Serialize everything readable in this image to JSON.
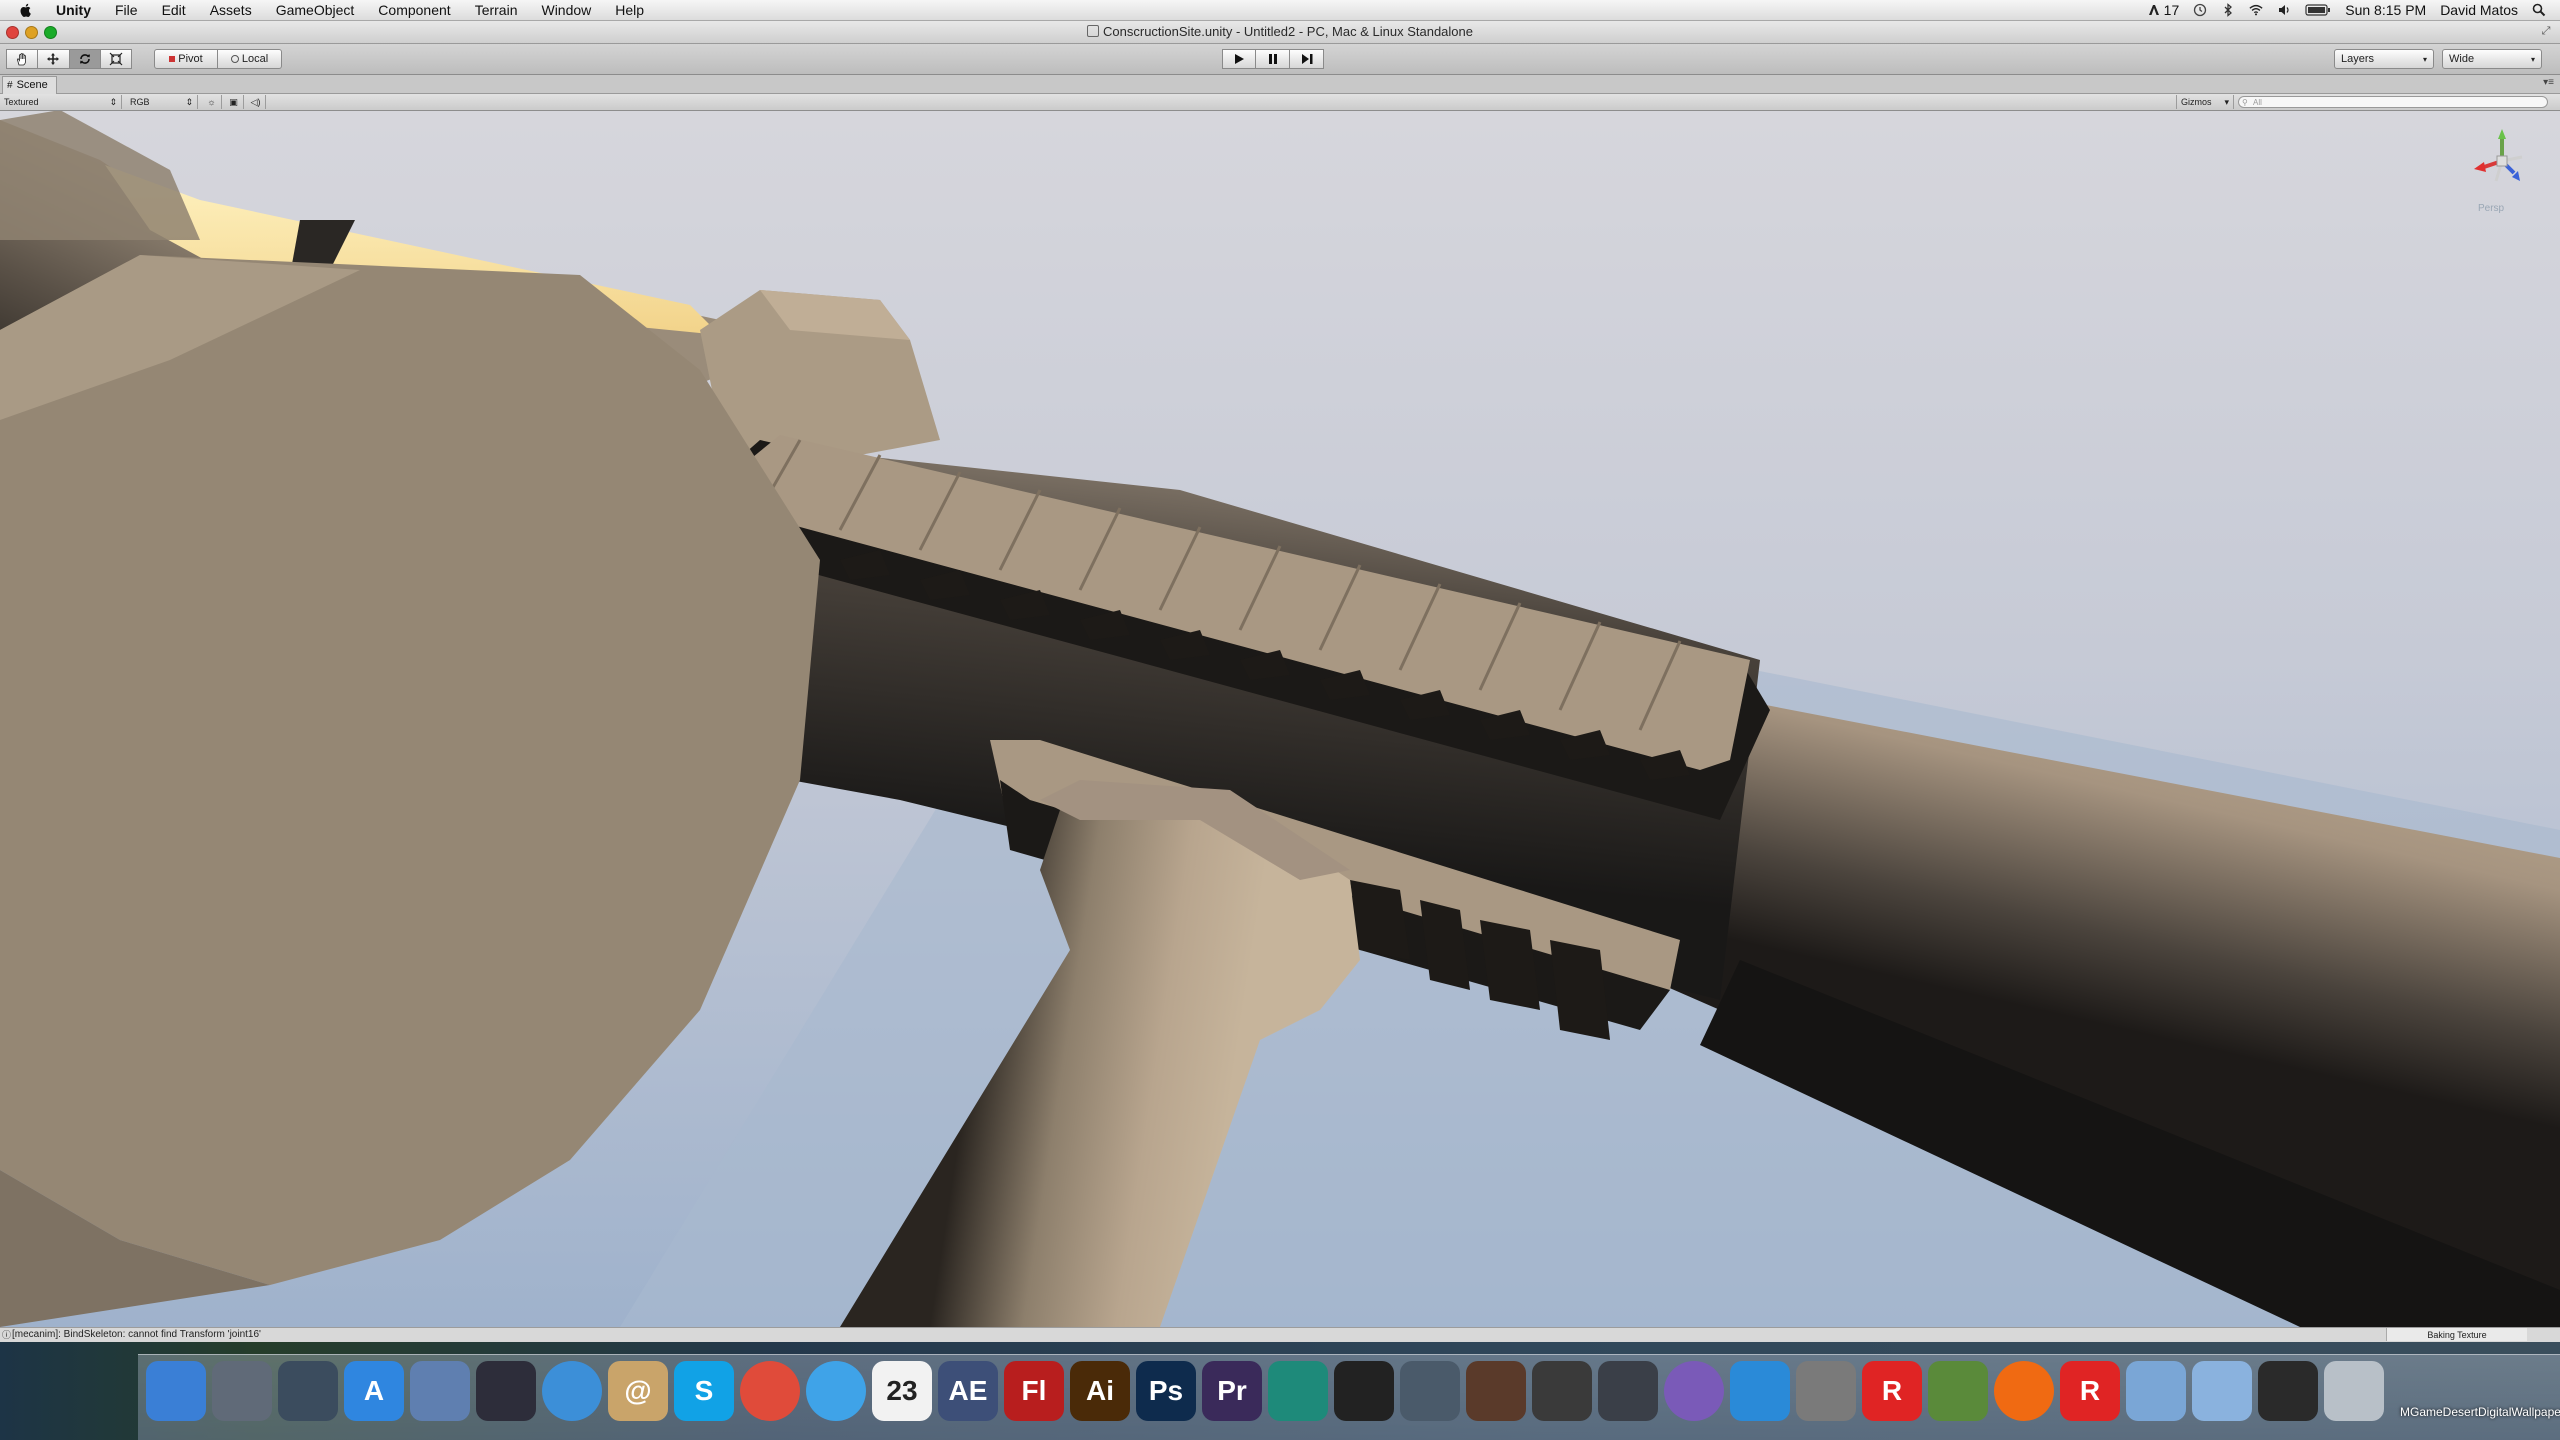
{
  "menubar": {
    "app": "Unity",
    "items": [
      "File",
      "Edit",
      "Assets",
      "GameObject",
      "Component",
      "Terrain",
      "Window",
      "Help"
    ],
    "status_badge": "17",
    "clock": "Sun 8:15 PM",
    "user": "David Matos"
  },
  "window": {
    "title": "ConscructionSite.unity - Untitled2 - PC, Mac & Linux Standalone"
  },
  "toolbar": {
    "pivot_label": "Pivot",
    "local_label": "Local",
    "layers_label": "Layers",
    "layout_label": "Wide"
  },
  "scene": {
    "tab_label": "Scene",
    "draw_mode": "Textured",
    "render_mode": "RGB",
    "gizmos_label": "Gizmos",
    "search_placeholder": "All",
    "gizmo_label": "Persp"
  },
  "status": {
    "message": "[mecanim]: BindSkeleton: cannot find Transform 'joint16'",
    "progress_label": "Baking Texture"
  },
  "dock": {
    "items": [
      {
        "name": "finder",
        "label": "",
        "color": "#3a7fd6"
      },
      {
        "name": "launchpad",
        "label": "",
        "color": "#606a78"
      },
      {
        "name": "mission-control",
        "label": "",
        "color": "#3b4c5e"
      },
      {
        "name": "app-store",
        "label": "A",
        "color": "#2f86e0"
      },
      {
        "name": "preview",
        "label": "",
        "color": "#5f7fb0"
      },
      {
        "name": "pencil-app",
        "label": "",
        "color": "#2d2d3a"
      },
      {
        "name": "safari",
        "label": "",
        "color": "#3c8fd8"
      },
      {
        "name": "contacts",
        "label": "@",
        "color": "#c9a46a"
      },
      {
        "name": "skype",
        "label": "S",
        "color": "#11a2e6"
      },
      {
        "name": "chrome",
        "label": "",
        "color": "#e04b3a"
      },
      {
        "name": "itunes",
        "label": "",
        "color": "#3fa3e8"
      },
      {
        "name": "calendar",
        "label": "23",
        "color": "#f2f2f2"
      },
      {
        "name": "after-effects",
        "label": "AE",
        "color": "#3d4f78"
      },
      {
        "name": "flash",
        "label": "Fl",
        "color": "#b81e1e"
      },
      {
        "name": "illustrator",
        "label": "Ai",
        "color": "#4a2a08"
      },
      {
        "name": "photoshop",
        "label": "Ps",
        "color": "#0e2b4d"
      },
      {
        "name": "premiere",
        "label": "Pr",
        "color": "#3a2a5a"
      },
      {
        "name": "maya",
        "label": "",
        "color": "#1e8a7a"
      },
      {
        "name": "unity",
        "label": "",
        "color": "#222222"
      },
      {
        "name": "unity-remote",
        "label": "",
        "color": "#4a5a6a"
      },
      {
        "name": "garageband",
        "label": "",
        "color": "#5a3a2a"
      },
      {
        "name": "imovie",
        "label": "",
        "color": "#3a3a3a"
      },
      {
        "name": "steam",
        "label": "",
        "color": "#3a3f48"
      },
      {
        "name": "sphere-app",
        "label": "",
        "color": "#7a5ab8"
      },
      {
        "name": "snowflake-app",
        "label": "",
        "color": "#2a8ad8"
      },
      {
        "name": "system-preferences",
        "label": "",
        "color": "#7a7a7a"
      },
      {
        "name": "roblox",
        "label": "R",
        "color": "#e02424"
      },
      {
        "name": "minecraft",
        "label": "",
        "color": "#5a8a3a"
      },
      {
        "name": "origin",
        "label": "",
        "color": "#f06a12"
      },
      {
        "name": "roblox-studio",
        "label": "R",
        "color": "#e02424"
      },
      {
        "name": "applications-folder",
        "label": "",
        "color": "#7aa6d6"
      },
      {
        "name": "documents-folder",
        "label": "",
        "color": "#8ab2de"
      },
      {
        "name": "music-folder",
        "label": "",
        "color": "#2a2a2a"
      },
      {
        "name": "trash",
        "label": "",
        "color": "#b8c0c8"
      }
    ],
    "desktop_file_label": "MGameDesertDigitalWallpaper.jpg"
  }
}
